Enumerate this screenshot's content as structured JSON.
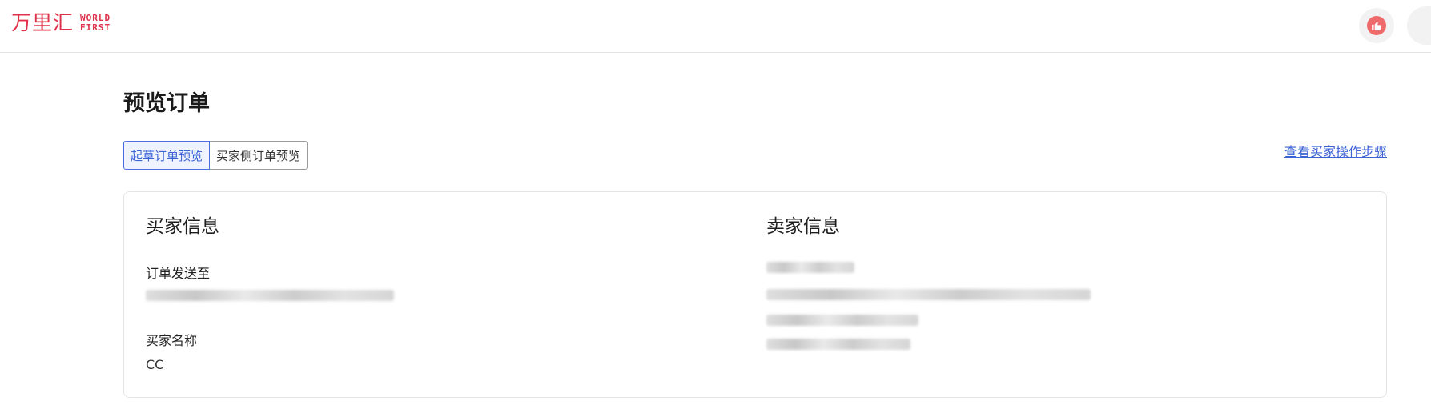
{
  "header": {
    "logo_cn": "万里汇",
    "logo_en_line1": "WORLD",
    "logo_en_line2": "FIRST",
    "like_icon": "thumbs-up-icon"
  },
  "page": {
    "title": "预览订单"
  },
  "tabs": [
    {
      "label": "起草订单预览",
      "active": true
    },
    {
      "label": "买家侧订单预览",
      "active": false
    }
  ],
  "links": {
    "view_buyer_steps": "查看买家操作步骤"
  },
  "buyer": {
    "title": "买家信息",
    "send_to_label": "订单发送至",
    "send_to_value": "",
    "name_label": "买家名称",
    "name_value": "CC"
  },
  "seller": {
    "title": "卖家信息",
    "lines": [
      "",
      "",
      "",
      ""
    ]
  },
  "colors": {
    "brand": "#e0314b",
    "link": "#3b63d6",
    "active_tab_bg": "#eef3ff"
  }
}
